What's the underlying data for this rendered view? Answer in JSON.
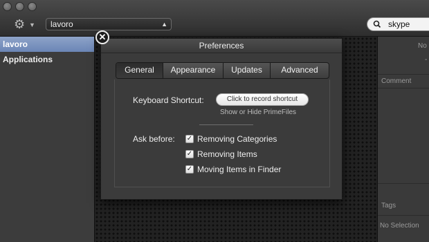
{
  "toolbar": {
    "collection_popup": {
      "value": "lavoro"
    },
    "search": {
      "value": "skype"
    },
    "gear_icon": "gear-icon",
    "search_icon": "magnifier-icon"
  },
  "sidebar": {
    "items": [
      {
        "label": "lavoro",
        "selected": true
      },
      {
        "label": "Applications",
        "selected": false
      }
    ]
  },
  "info_panel": {
    "no_text": "No",
    "dash": "-",
    "comment_label": "Comment",
    "tags_label": "Tags",
    "no_selection": "No Selection"
  },
  "preferences": {
    "title": "Preferences",
    "tabs": [
      {
        "label": "General",
        "active": true
      },
      {
        "label": "Appearance",
        "active": false
      },
      {
        "label": "Updates",
        "active": false
      },
      {
        "label": "Advanced",
        "active": false
      }
    ],
    "keyboard_shortcut_label": "Keyboard Shortcut:",
    "record_button": "Click to record shortcut",
    "shortcut_hint": "Show or Hide PrimeFiles",
    "ask_before_label": "Ask before:",
    "ask_options": [
      {
        "label": "Removing Categories",
        "checked": true
      },
      {
        "label": "Removing Items",
        "checked": true
      },
      {
        "label": "Moving Items in Finder",
        "checked": true
      }
    ]
  }
}
